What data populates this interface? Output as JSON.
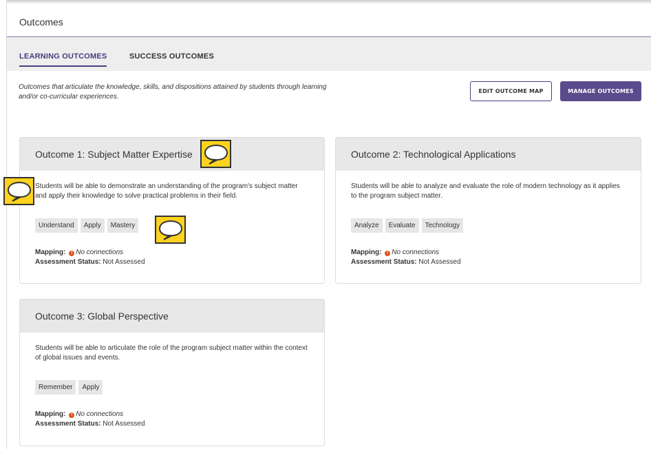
{
  "header": {
    "title": "Outcomes"
  },
  "tabs": [
    {
      "label": "LEARNING OUTCOMES",
      "active": true
    },
    {
      "label": "SUCCESS OUTCOMES",
      "active": false
    }
  ],
  "intro": "Outcomes that articulate the knowledge, skills, and dispositions attained by students through learning and/or co-curricular experiences.",
  "buttons": {
    "edit": "EDIT OUTCOME MAP",
    "manage": "MANAGE OUTCOMES"
  },
  "labels": {
    "mapping": "Mapping:",
    "assessment": "Assessment Status:"
  },
  "outcomes": [
    {
      "title": "Outcome 1: Subject Matter Expertise",
      "description": "Students will be able to demonstrate an understanding of the program's subject matter and apply their knowledge to solve practical problems in their field.",
      "tags": [
        "Understand",
        "Apply",
        "Mastery"
      ],
      "mapping": "No connections",
      "status": "Not Assessed"
    },
    {
      "title": "Outcome 2: Technological Applications",
      "description": "Students will be able to analyze and evaluate the role of modern technology as it applies to the program subject matter.",
      "tags": [
        "Analyze",
        "Evaluate",
        "Technology"
      ],
      "mapping": "No connections",
      "status": "Not Assessed"
    },
    {
      "title": "Outcome 3: Global Perspective",
      "description": "Students will be able to articulate the role of the program subject matter within the context of global issues and events.",
      "tags": [
        "Remember",
        "Apply"
      ],
      "mapping": "No connections",
      "status": "Not Assessed"
    }
  ],
  "colors": {
    "accent": "#4a3c7e",
    "primary_button": "#5a4b8c",
    "warning": "#d9541e",
    "comment_bubble": "#ffd21f"
  },
  "icons": {
    "warning": "warning-icon",
    "comment": "comment-bubble-icon"
  }
}
